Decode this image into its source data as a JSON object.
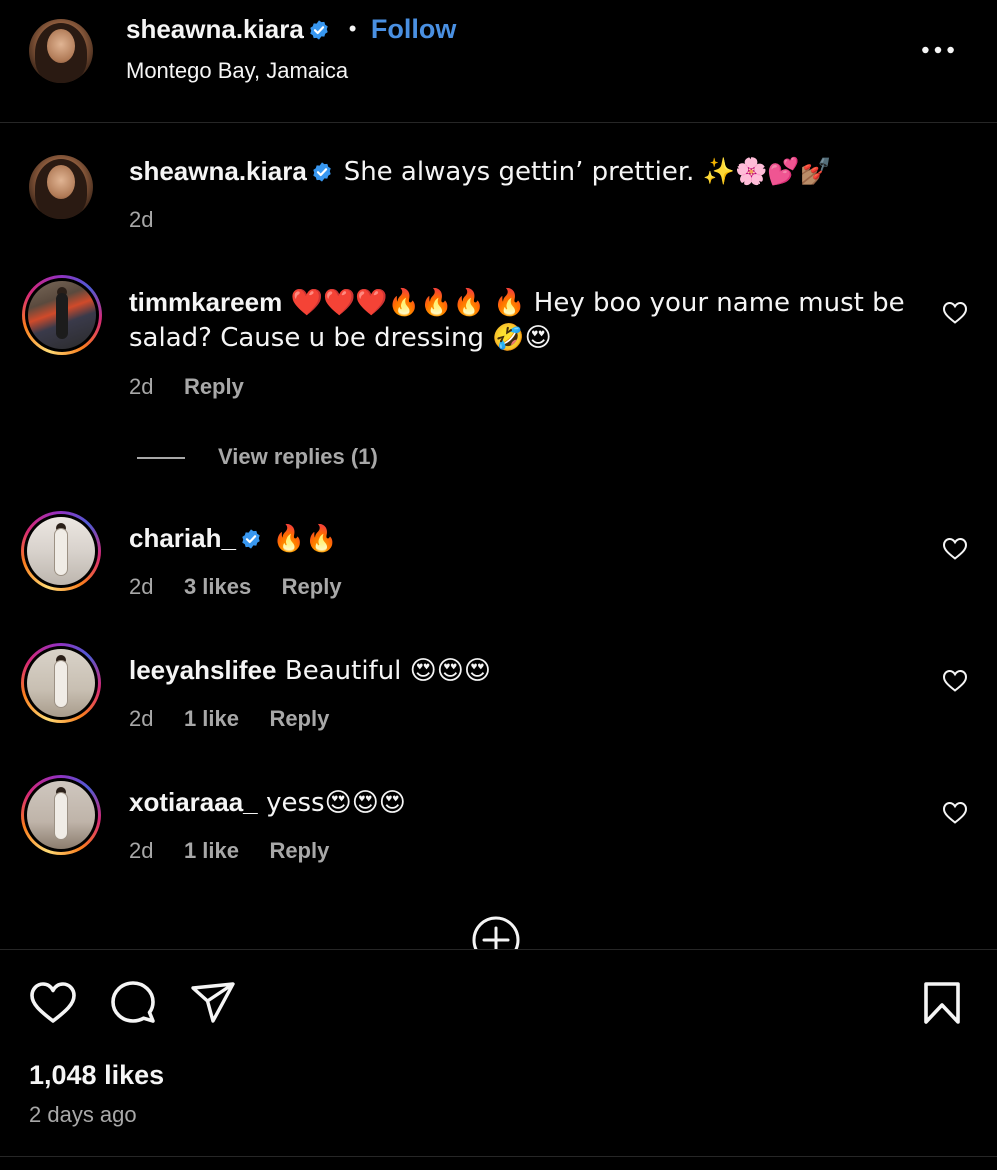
{
  "header": {
    "username": "sheawna.kiara",
    "separator": "•",
    "follow_label": "Follow",
    "location": "Montego Bay, Jamaica",
    "more_icon": "more-horizontal-icon"
  },
  "caption": {
    "username": "sheawna.kiara",
    "text": "She always gettin’ prettier. ✨🌸💕💅🏽",
    "time": "2d"
  },
  "comments": [
    {
      "username": "timmkareem",
      "text_line1": "❤️❤️❤️🔥🔥🔥 🔥 Hey boo your name must be",
      "text_line2": "salad? Cause u be dressing 🤣😍",
      "time": "2d",
      "likes": "",
      "reply": "Reply",
      "view_replies": "View replies (1)"
    },
    {
      "username": "chariah_",
      "verified": true,
      "text": "🔥🔥",
      "time": "2d",
      "likes": "3 likes",
      "reply": "Reply"
    },
    {
      "username": "leeyahslifee",
      "text": "Beautiful 😍😍😍",
      "time": "2d",
      "likes": "1 like",
      "reply": "Reply"
    },
    {
      "username": "xotiaraaa_",
      "text": "yess😍😍😍",
      "time": "2d",
      "likes": "1 like",
      "reply": "Reply"
    }
  ],
  "actions": {
    "like_icon": "heart-icon",
    "comment_icon": "comment-icon",
    "share_icon": "send-icon",
    "save_icon": "bookmark-icon",
    "load_more_icon": "plus-circle-icon"
  },
  "footer": {
    "likes": "1,048 likes",
    "posted": "2 days ago"
  },
  "colors": {
    "background": "#000000",
    "text": "#f5f5f5",
    "muted": "#a8a8a8",
    "follow": "#4a90e2",
    "verified": "#3897f0",
    "divider": "#262626"
  }
}
